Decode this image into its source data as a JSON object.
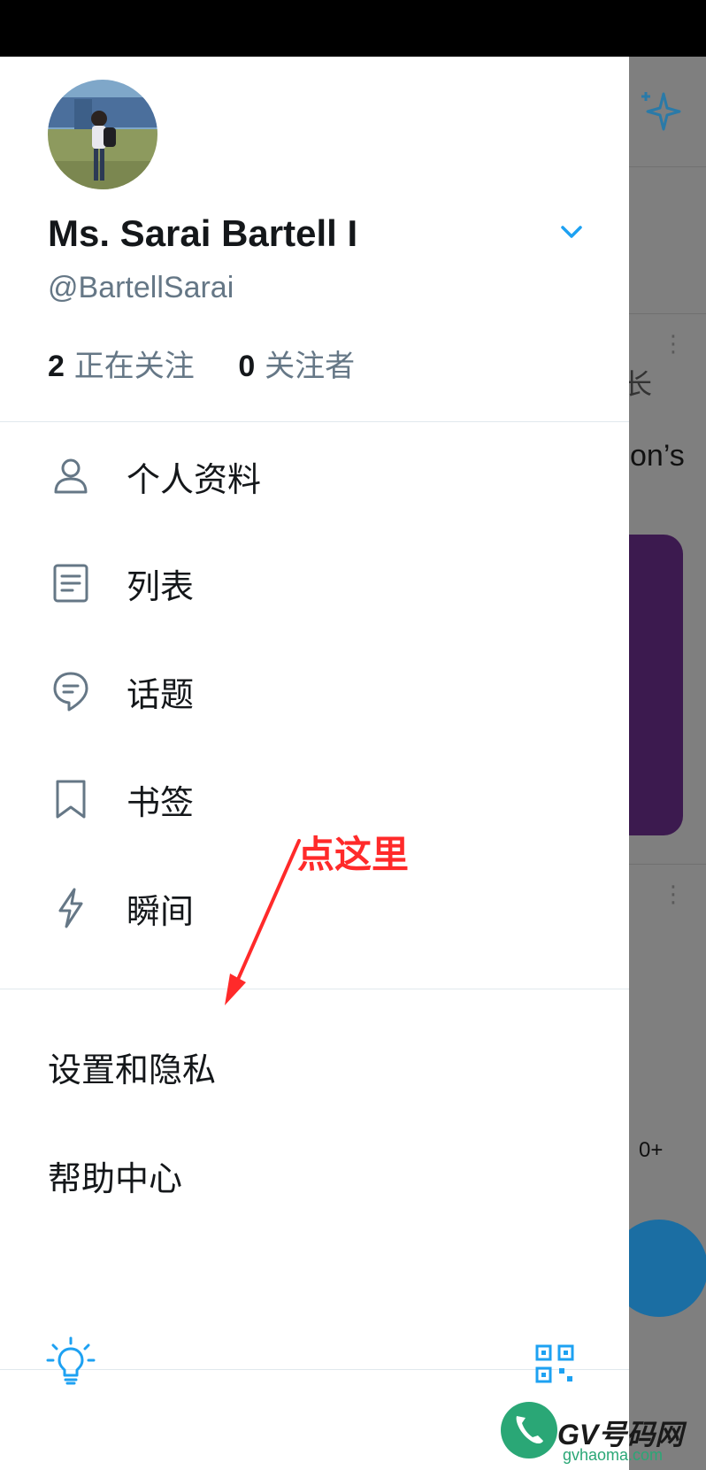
{
  "account": {
    "name": "Ms. Sarai Bartell I",
    "handle": "@BartellSarai",
    "following_count": "2",
    "following_label": "正在关注",
    "followers_count": "0",
    "followers_label": "关注者"
  },
  "menu": [
    {
      "label": "个人资料",
      "icon": "person-icon"
    },
    {
      "label": "列表",
      "icon": "list-icon"
    },
    {
      "label": "话题",
      "icon": "topics-icon"
    },
    {
      "label": "书签",
      "icon": "bookmark-icon"
    },
    {
      "label": "瞬间",
      "icon": "moments-icon"
    }
  ],
  "settings": {
    "settings_privacy": "设置和隐私",
    "help_center": "帮助中心"
  },
  "annotation": {
    "text": "点这里",
    "color": "#ff2a2a"
  },
  "background": {
    "partial_text": "on’s",
    "partial_text2": "长",
    "count": "0+"
  },
  "watermark": {
    "title": "GV号码网",
    "url": "gvhaoma.com"
  },
  "colors": {
    "accent": "#1da1f2",
    "secondary_text": "#657786",
    "divider": "#e1e8ed"
  }
}
